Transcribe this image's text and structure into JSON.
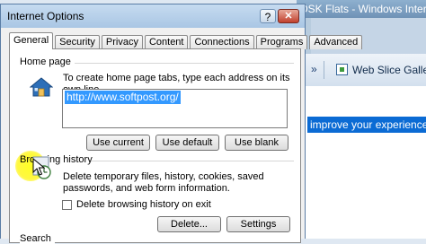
{
  "background_window": {
    "title": "DSK Flats - Windows Intern",
    "toolbar_chevron": "»",
    "web_slice_label": "Web Slice Gallery",
    "info_bar_text": "improve your experience."
  },
  "dialog": {
    "title": "Internet Options",
    "help_label": "?",
    "close_label": "✕",
    "tabs": [
      {
        "label": "General",
        "active": true
      },
      {
        "label": "Security",
        "active": false
      },
      {
        "label": "Privacy",
        "active": false
      },
      {
        "label": "Content",
        "active": false
      },
      {
        "label": "Connections",
        "active": false
      },
      {
        "label": "Programs",
        "active": false
      },
      {
        "label": "Advanced",
        "active": false
      }
    ],
    "home_page": {
      "title": "Home page",
      "description": "To create home page tabs, type each address on its own line.",
      "url": "http://www.softpost.org/",
      "buttons": {
        "use_current": "Use current",
        "use_default": "Use default",
        "use_blank": "Use blank"
      }
    },
    "browsing_history": {
      "title": "Browsing history",
      "description": "Delete temporary files, history, cookies, saved passwords, and web form information.",
      "checkbox_label": "Delete browsing history on exit",
      "checkbox_checked": false,
      "buttons": {
        "delete": "Delete...",
        "settings": "Settings"
      }
    },
    "search": {
      "title": "Search"
    }
  },
  "colors": {
    "selection": "#3399ff",
    "info_bar": "#0b6bd4",
    "cursor_highlight": "#ffff00"
  }
}
